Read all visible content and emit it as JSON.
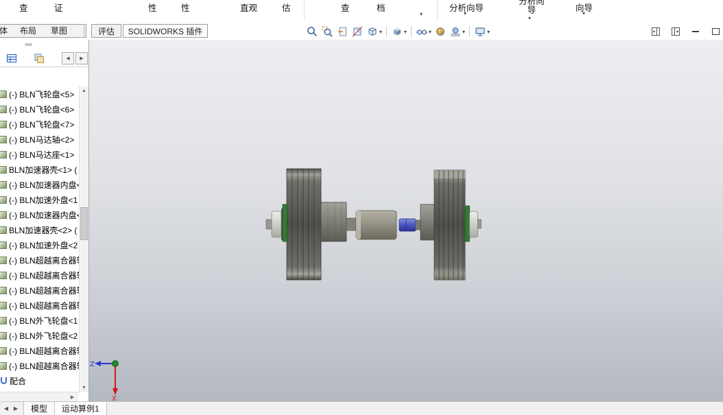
{
  "glyphs": {
    "caret_down": "▾",
    "arrow_left": "◀",
    "arrow_right": "▶",
    "scroll_up": "▲",
    "scroll_down": "▼"
  },
  "ribbon": {
    "fragments": [
      "查",
      "证",
      "性",
      "性",
      "直观",
      "估",
      "查",
      "档",
      "分析向导",
      "分析向导",
      "向导"
    ]
  },
  "tab_bar": {
    "tabs": [
      "装配体",
      "布局",
      "草图",
      "评估",
      "SOLIDWORKS 插件"
    ]
  },
  "headsup_toolbar": {
    "buttons": [
      {
        "name": "zoom-to-fit"
      },
      {
        "name": "zoom-to-area"
      },
      {
        "name": "previous-view"
      },
      {
        "name": "section-view"
      },
      {
        "name": "view-orientation",
        "dropdown": true
      },
      {
        "name": "display-style",
        "dropdown": true
      },
      {
        "name": "hide-show-items",
        "dropdown": true
      },
      {
        "name": "edit-appearance"
      },
      {
        "name": "apply-scene",
        "dropdown": true
      },
      {
        "name": "view-settings",
        "dropdown": true
      }
    ]
  },
  "feature_tree": {
    "items": [
      "(-) BLN飞轮盘<5>",
      "(-) BLN飞轮盘<6>",
      "(-) BLN飞轮盘<7>",
      "(-) BLN马达轴<2>",
      "(-) BLN马达座<1>",
      "BLN加速器壳<1> (",
      "(-) BLN加速器内盘<",
      "(-) BLN加速外盘<1",
      "(-) BLN加速器内盘<",
      "BLN加速器壳<2> (",
      "(-) BLN加速外盘<2",
      "(-) BLN超越离合器轴",
      "(-) BLN超越离合器轴",
      "(-) BLN超越离合器轴",
      "(-) BLN超越离合器轴",
      "(-) BLN外飞轮盘<1",
      "(-) BLN外飞轮盘<2",
      "(-) BLN超越离合器轴",
      "(-) BLN超越离合器轴",
      "配合"
    ]
  },
  "bottom_bar": {
    "tabs": [
      "模型",
      "运动算例1"
    ]
  },
  "triad": {
    "z_label": "Z",
    "x_label": "X"
  },
  "colors": {
    "viewport_top": "#eceef0",
    "viewport_bottom": "#b4b8c0",
    "model_green": "#2f7d33",
    "model_blue": "#4a55c0",
    "motor_gray": "#9d9a8e"
  }
}
